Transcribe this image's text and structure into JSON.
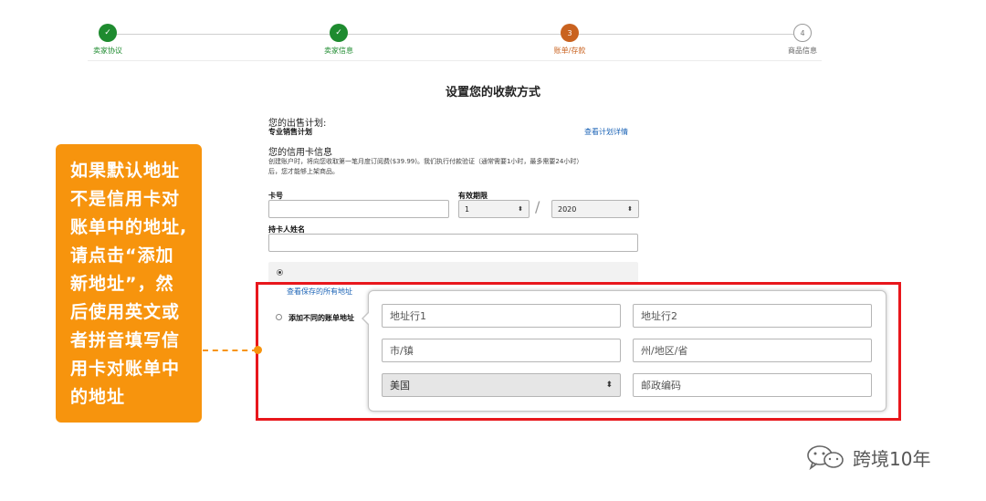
{
  "stepper": {
    "steps": [
      {
        "label": "卖家协议",
        "state": "done",
        "marker": "✓"
      },
      {
        "label": "卖家信息",
        "state": "done",
        "marker": "✓"
      },
      {
        "label": "账单/存款",
        "state": "current",
        "marker": "3"
      },
      {
        "label": "商品信息",
        "state": "todo",
        "marker": "4"
      }
    ]
  },
  "page_title": "设置您的收款方式",
  "plan": {
    "heading": "您的出售计划:",
    "name": "专业销售计划",
    "details_link": "查看计划详情"
  },
  "card": {
    "heading": "您的信用卡信息",
    "desc_line1": "创建账户时，将向您收取第一笔月度订阅费($39.99)。我们执行付款验证（通常需要1小时，最多需要24小时）",
    "desc_line2": "后，您才能够上架商品。",
    "number_label": "卡号",
    "expiry_label": "有效期限",
    "expiry_month": "1",
    "expiry_year": "2020",
    "expiry_sep": "/",
    "holder_label": "持卡人姓名"
  },
  "address": {
    "view_saved_link": "查看保存的所有地址",
    "add_different_label": "添加不同的账单地址",
    "line1_placeholder": "地址行1",
    "line2_placeholder": "地址行2",
    "city_placeholder": "市/镇",
    "state_placeholder": "州/地区/省",
    "country": "美国",
    "zip_placeholder": "邮政编码"
  },
  "callout": {
    "lines": [
      "如果默认地址",
      "不是信用卡对",
      "账单中的地址,",
      "请点击“添加",
      "新地址”，然",
      "后使用英文或",
      "者拼音填写信",
      "用卡对账单中",
      "的地址"
    ]
  },
  "watermark": "跨境10年",
  "colors": {
    "done": "#1e8b2f",
    "current": "#c9621f",
    "callout": "#f7940d",
    "highlight": "#e8171c",
    "link": "#1b63b6"
  }
}
